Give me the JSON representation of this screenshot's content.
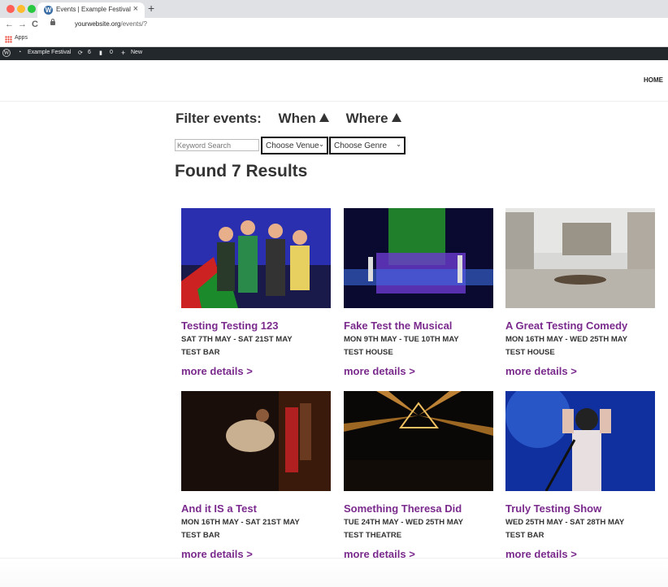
{
  "browser": {
    "tab_title": "Events | Example Festival",
    "tab_close": "×",
    "new_tab": "+",
    "url_host": "yourwebsite.org",
    "url_path": "/events/?",
    "back": "←",
    "forward": "→",
    "reload": "C",
    "bookmarks_apps": "Apps"
  },
  "admin_bar": {
    "wp_logo": "W",
    "site_name": "Example Festival",
    "updates_count": "6",
    "comments_count": "0",
    "new_label": "New"
  },
  "header": {
    "menu_home": "HOME"
  },
  "filters": {
    "label": "Filter events:",
    "when": "When",
    "where": "Where",
    "keyword_placeholder": "Keyword Search",
    "venue_selected": "Choose Venue",
    "genre_selected": "Choose Genre"
  },
  "results": {
    "heading": "Found 7 Results"
  },
  "events": [
    {
      "title": "Testing Testing 123",
      "dates": "SAT 7TH MAY - SAT 21ST MAY",
      "venue": "TEST BAR",
      "more": "more details >"
    },
    {
      "title": "Fake Test the Musical",
      "dates": "MON 9TH MAY - TUE 10TH MAY",
      "venue": "TEST HOUSE",
      "more": "more details >"
    },
    {
      "title": "A Great Testing Comedy",
      "dates": "MON 16TH MAY - WED 25TH MAY",
      "venue": "TEST HOUSE",
      "more": "more details >"
    },
    {
      "title": "And it IS a Test",
      "dates": "MON 16TH MAY - SAT 21ST MAY",
      "venue": "TEST BAR",
      "more": "more details >"
    },
    {
      "title": "Something Theresa Did",
      "dates": "TUE 24TH MAY - WED 25TH MAY",
      "venue": "TEST THEATRE",
      "more": "more details >"
    },
    {
      "title": "Truly Testing Show",
      "dates": "WED 25TH MAY - SAT 28TH MAY",
      "venue": "TEST BAR",
      "more": "more details >"
    }
  ]
}
